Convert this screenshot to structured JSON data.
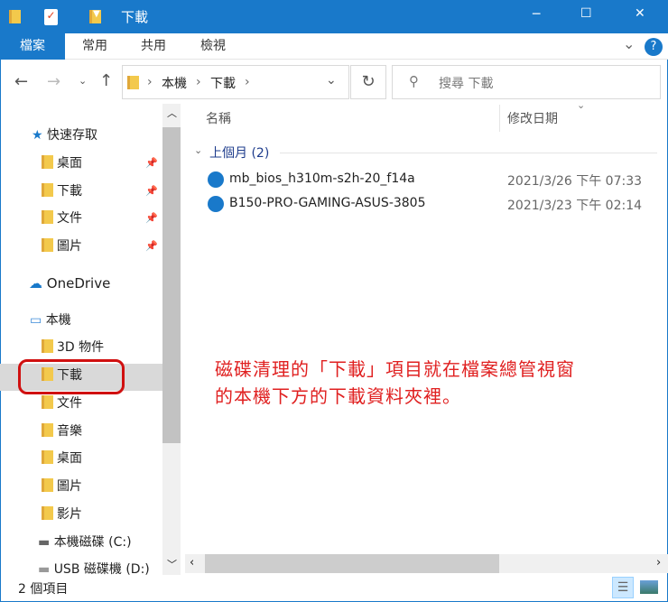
{
  "window": {
    "title": "下載",
    "minimize": "─",
    "maximize": "☐",
    "close": "✕"
  },
  "ribbon": {
    "tabs": [
      "檔案",
      "常用",
      "共用",
      "檢視"
    ],
    "help": "?",
    "expand": "⌄"
  },
  "address": {
    "path": [
      "本機",
      "下載"
    ],
    "search_placeholder": "搜尋 下載"
  },
  "nav": {
    "quick_access": "快速存取",
    "quick_items": [
      "桌面",
      "下載",
      "文件",
      "圖片"
    ],
    "onedrive": "OneDrive",
    "this_pc": "本機",
    "pc_items": [
      "3D 物件",
      "下載",
      "文件",
      "音樂",
      "桌面",
      "圖片",
      "影片",
      "本機磁碟 (C:)",
      "USB 磁碟機 (D:)"
    ]
  },
  "content": {
    "col_name": "名稱",
    "col_date": "修改日期",
    "group": "上個月 (2)",
    "files": [
      {
        "name": "mb_bios_h310m-s2h-20_f14a",
        "date": "2021/3/26 下午 07:33"
      },
      {
        "name": "B150-PRO-GAMING-ASUS-3805",
        "date": "2021/3/23 下午 02:14"
      }
    ]
  },
  "annotation": {
    "line1": "磁碟清理的「下載」項目就在檔案總管視窗",
    "line2": "的本機下方的下載資料夾裡。",
    "color": "#e02020"
  },
  "status": {
    "count": "2 個項目"
  }
}
